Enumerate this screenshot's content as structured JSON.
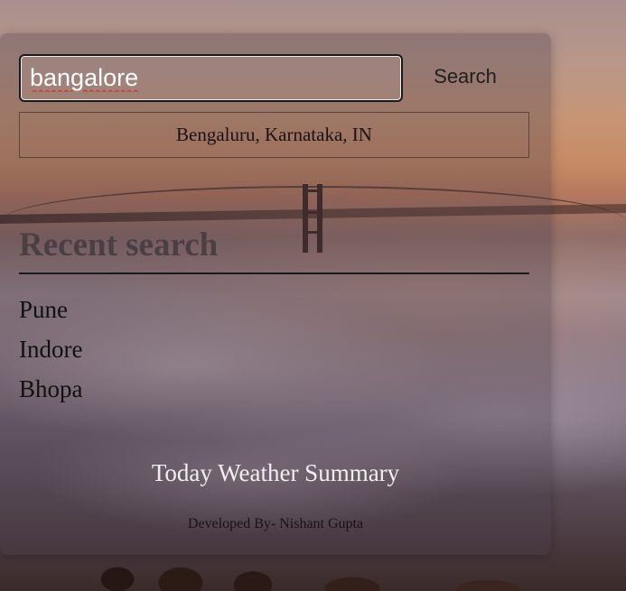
{
  "search": {
    "value": "bangalore",
    "button_label": "Search"
  },
  "suggestion": {
    "label": "Bengaluru, Karnataka, IN"
  },
  "recent": {
    "title": "Recent search",
    "items": [
      "Pune",
      "Indore",
      "Bhopa"
    ]
  },
  "summary": {
    "title": "Today Weather Summary"
  },
  "footer": {
    "credit": "Developed By- Nishant Gupta"
  },
  "colors": {
    "panel": "#463c46",
    "title": "#4a3f44",
    "summary_text": "#f2eef0"
  }
}
